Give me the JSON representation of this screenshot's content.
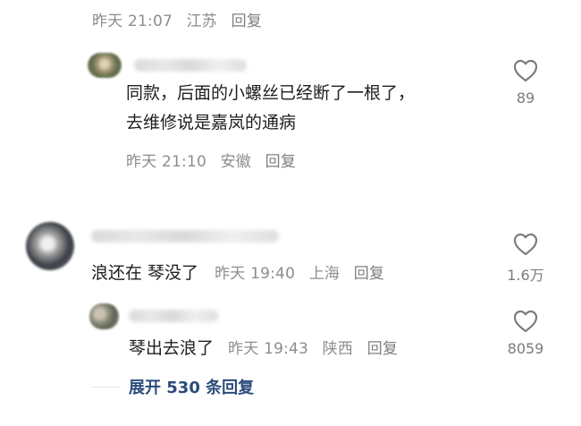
{
  "thread": {
    "top_meta": {
      "time": "昨天 21:07",
      "location": "江苏",
      "reply": "回复"
    },
    "comments": [
      {
        "text_line1": "同款，后面的小螺丝已经断了一根了，",
        "text_line2": "去维修说是嘉岚的通病",
        "time": "昨天 21:10",
        "location": "安徽",
        "reply": "回复",
        "likes": "89"
      },
      {
        "text": "浪还在 琴没了",
        "time": "昨天 19:40",
        "location": "上海",
        "reply": "回复",
        "likes": "1.6万"
      },
      {
        "text": "琴出去浪了",
        "time": "昨天 19:43",
        "location": "陕西",
        "reply": "回复",
        "likes": "8059"
      }
    ],
    "expand_text": "展开 530 条回复"
  },
  "icons": {
    "like": "heart-outline-icon",
    "avatar": "blurred-avatar",
    "name": "blurred-username"
  },
  "colors": {
    "meta": "#8d8d8d",
    "body": "#202020",
    "link": "#2b4b7b",
    "icon": "#7d7d7d"
  }
}
